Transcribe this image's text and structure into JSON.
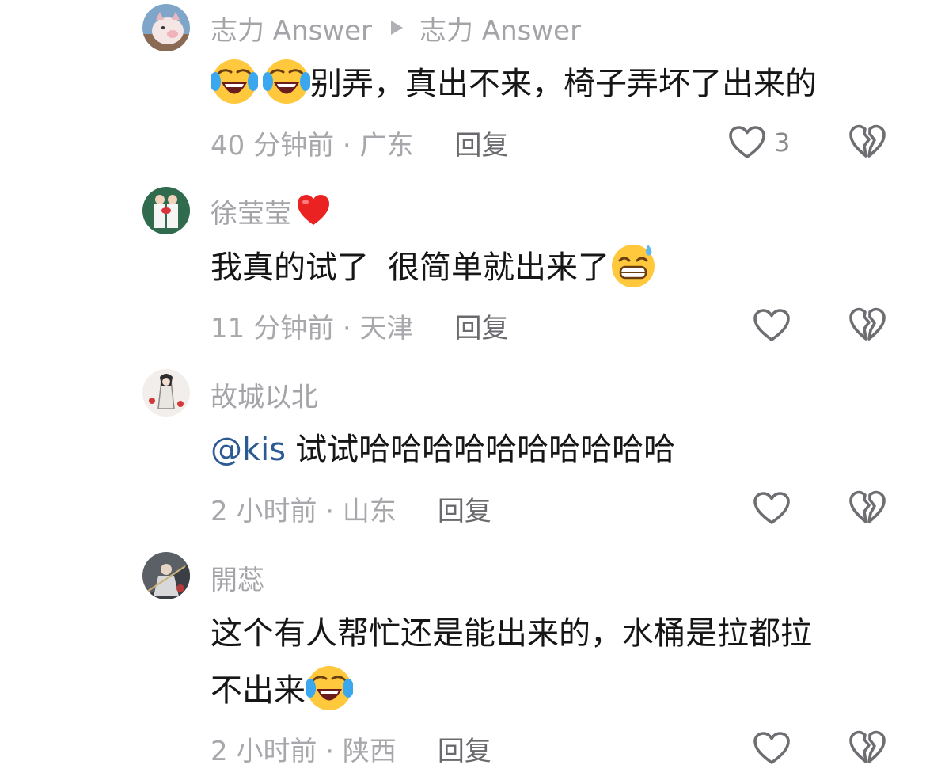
{
  "colors": {
    "username": "#a4a4a8",
    "body_text": "#161616",
    "mention": "#2c5a93",
    "meta": "#a8a8ac",
    "reply": "#6a6a6e",
    "icon_stroke": "#6d6d72"
  },
  "comments": [
    {
      "username": "志力 Answer",
      "reply_to": "志力 Answer",
      "avatar": "pig-avatar",
      "text_lines": [
        "别弄，真出不来，椅子弄坏了出来的"
      ],
      "leading_emojis": [
        "laugh-cry-emoji",
        "laugh-cry-emoji"
      ],
      "time_location": "40 分钟前 · 广东",
      "reply_label": "回复",
      "like_count": "3"
    },
    {
      "username": "徐莹莹",
      "name_emoji": "red-heart-emoji",
      "avatar": "couple-photo-avatar",
      "text_a": "我真的试了",
      "text_b": "很简单就出来了",
      "trailing_emoji": "grin-sweat-emoji",
      "time_location": "11 分钟前 · 天津",
      "reply_label": "回复"
    },
    {
      "username": "故城以北",
      "avatar": "ink-figure-avatar",
      "mention": "@kis",
      "text": "试试哈哈哈哈哈哈哈哈哈哈",
      "time_location": "2 小时前 · 山东",
      "reply_label": "回复"
    },
    {
      "username": "開蕊",
      "avatar": "warrior-art-avatar",
      "text_line1": "这个有人帮忙还是能出来的，水桶是拉都拉",
      "text_line2": "不出来",
      "trailing_emoji": "laugh-cry-emoji",
      "time_location": "2 小时前 · 陕西",
      "reply_label": "回复"
    }
  ]
}
